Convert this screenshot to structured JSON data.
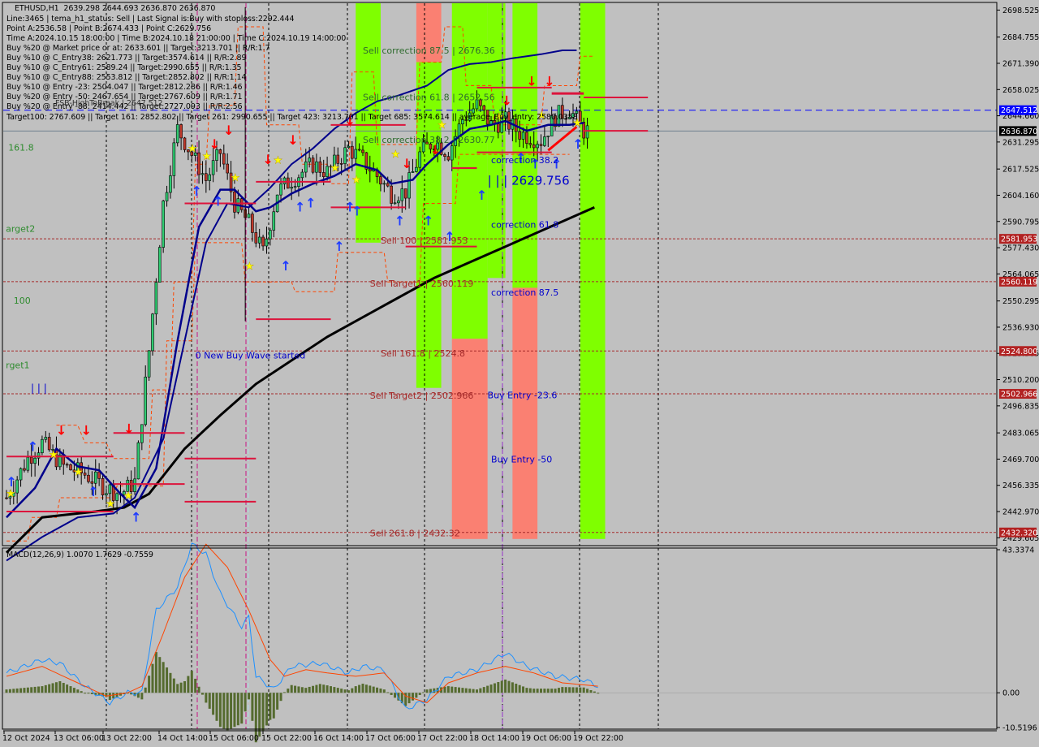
{
  "window": {
    "symbol": "ETHUSD,H1",
    "ohlc": "2639.298 2644.693 2636.870 2636.870"
  },
  "info_lines": [
    "Line:3465 | tema_h1_status: Sell | Last Signal is:Buy with stoploss:2292.444",
    "Point A:2536.58 | Point B:2674.433 | Point C:2629.756",
    "Time A:2024.10.15 18:00:00 | Time B:2024.10.18 21:00:00 | Time C:2024.10.19 14:00:00",
    "Buy %20 @ Market price or at: 2633.601 || Target:3213.701 || R/R:1.7",
    "Buy %10 @ C_Entry38: 2621.773 || Target:3574.614 || R/R:2.89",
    "Buy %10 @ C_Entry61: 2589.24 || Target:2990.655 || R/R:1.35",
    "Buy %10 @ C_Entry88: 2553.812 || Target:2852.802 || R/R:1.14",
    "Buy %10 @ Entry -23: 2504.047 || Target:2812.286 || R/R:1.46",
    "Buy %20 @ Entry -50: 2467.654 || Target:2767.609 || R/R:1.71",
    "Buy %20 @ Entry -88: 2414.442 || Target:2727.093 || R/R:2.56"
  ],
  "targets_line": "Target100: 2767.609 || Target 161: 2852.802 || Target 261: 2990.655 || Target 423: 3213.701 || Target 685: 3574.614 || average_Buy_entry: 2580.0358",
  "fsb_label": "FSB-HighToBreak | 2647.512",
  "chart_data": {
    "type": "candlestick",
    "title": "ETHUSD,H1",
    "price_axis": {
      "ylim": [
        2425.605,
        2702
      ],
      "ticks": [
        "2698.525",
        "2684.755",
        "2671.390",
        "2658.025",
        "2644.660",
        "2631.295",
        "2617.525",
        "2604.160",
        "2590.795",
        "2577.430",
        "2564.065",
        "2550.295",
        "2536.930",
        "2523.565",
        "2510.200",
        "2496.835",
        "2483.065",
        "2469.700",
        "2456.335",
        "2442.970",
        "2429.605"
      ]
    },
    "time_axis": {
      "labels": [
        "12 Oct 2024",
        "13 Oct 06:00",
        "13 Oct 22:00",
        "14 Oct 14:00",
        "15 Oct 06:00",
        "15 Oct 22:00",
        "16 Oct 14:00",
        "17 Oct 06:00",
        "17 Oct 22:00",
        "18 Oct 14:00",
        "19 Oct 06:00",
        "19 Oct 22:00"
      ],
      "bars_total": 185
    },
    "price_tags": [
      {
        "value": "2647.512",
        "price": 2647.512,
        "bg": "#0000ff",
        "fg": "#ffffff"
      },
      {
        "value": "2636.870",
        "price": 2636.87,
        "bg": "#000000",
        "fg": "#ffffff"
      },
      {
        "value": "2581.953",
        "price": 2581.953,
        "bg": "#b22222",
        "fg": "#ffffff"
      },
      {
        "value": "2560.119",
        "price": 2560.119,
        "bg": "#b22222",
        "fg": "#ffffff"
      },
      {
        "value": "2524.800",
        "price": 2524.8,
        "bg": "#b22222",
        "fg": "#ffffff"
      },
      {
        "value": "2502.966",
        "price": 2502.966,
        "bg": "#b22222",
        "fg": "#ffffff"
      },
      {
        "value": "2432.320",
        "price": 2432.32,
        "bg": "#b22222",
        "fg": "#ffffff"
      }
    ],
    "horizontal_levels": [
      {
        "name": "fsb-high-to-break",
        "price": 2647.512,
        "color": "#0000ff",
        "style": "dashed"
      },
      {
        "name": "current-price",
        "price": 2636.87,
        "color": "#708090",
        "style": "solid"
      },
      {
        "name": "sell-100",
        "price": 2581.953,
        "color": "#a52a2a",
        "style": "dotted"
      },
      {
        "name": "sell-target1",
        "price": 2560.119,
        "color": "#a52a2a",
        "style": "dotted"
      },
      {
        "name": "sell-161-8",
        "price": 2524.8,
        "color": "#a52a2a",
        "style": "dotted"
      },
      {
        "name": "sell-target2",
        "price": 2502.966,
        "color": "#a52a2a",
        "style": "dotted"
      },
      {
        "name": "sell-261-8",
        "price": 2432.32,
        "color": "#a52a2a",
        "style": "dotted"
      }
    ],
    "annotations": [
      {
        "text": "Sell correction 87.5 | 2676.36",
        "price": 2676.36,
        "color": "#2e6b2e",
        "bar": 100
      },
      {
        "text": "Sell correction 61.8 | 2652.56",
        "price": 2652.56,
        "color": "#2e6b2e",
        "bar": 100
      },
      {
        "text": "Sell correction 38.2 | 2630.77",
        "price": 2630.77,
        "color": "#2e6b2e",
        "bar": 100
      },
      {
        "text": "Sell 100 | 2581.953",
        "price": 2579.5,
        "color": "#a52a2a",
        "bar": 105
      },
      {
        "text": "Sell Target1 | 2560.119",
        "price": 2557.5,
        "color": "#a52a2a",
        "bar": 102
      },
      {
        "text": "Sell 161.8 | 2524.8",
        "price": 2522.0,
        "color": "#a52a2a",
        "bar": 105
      },
      {
        "text": "Sell Target2 | 2502.966",
        "price": 2500.5,
        "color": "#a52a2a",
        "bar": 102
      },
      {
        "text": "Sell 261.8 | 2432.32",
        "price": 2430.3,
        "color": "#a52a2a",
        "bar": 102
      },
      {
        "text": "correction 38.2",
        "price": 2620.5,
        "color": "#0000cd",
        "bar": 136
      },
      {
        "text": "| | | 2629.756",
        "price": 2609.5,
        "color": "#0000cd",
        "bar": 135,
        "large": true
      },
      {
        "text": "correction 61.8",
        "price": 2587.5,
        "color": "#0000cd",
        "bar": 136
      },
      {
        "text": "correction 87.5",
        "price": 2553.0,
        "color": "#0000cd",
        "bar": 136
      },
      {
        "text": "Buy Entry -23.6",
        "price": 2500.8,
        "color": "#0000cd",
        "bar": 135
      },
      {
        "text": "Buy Entry -50",
        "price": 2468.0,
        "color": "#0000cd",
        "bar": 136
      },
      {
        "text": "0 New Buy Wave started",
        "price": 2521.0,
        "color": "#0000cd",
        "bar": 53
      },
      {
        "text": "161.8",
        "price": 2627.0,
        "color": "#2e8b2e",
        "bar": 0.5
      },
      {
        "text": "arget2",
        "price": 2585.5,
        "color": "#2e8b2e",
        "bar": -0.2
      },
      {
        "text": "100",
        "price": 2549.0,
        "color": "#2e8b2e",
        "bar": 2
      },
      {
        "text": "rget1",
        "price": 2516.0,
        "color": "#2e8b2e",
        "bar": -0.2
      }
    ],
    "zones": [
      {
        "from_bar": 98,
        "to_bar": 105,
        "top": 2702,
        "bottom": 2580,
        "color": "#7fff00"
      },
      {
        "from_bar": 115,
        "to_bar": 122,
        "top": 2702,
        "bottom": 2672,
        "color": "#fa8072"
      },
      {
        "from_bar": 115,
        "to_bar": 122,
        "top": 2672,
        "bottom": 2506,
        "color": "#7fff00"
      },
      {
        "from_bar": 125,
        "to_bar": 135,
        "top": 2702,
        "bottom": 2531,
        "color": "#7fff00"
      },
      {
        "from_bar": 125,
        "to_bar": 135,
        "top": 2531,
        "bottom": 2429,
        "color": "#fa8072"
      },
      {
        "from_bar": 135,
        "to_bar": 140,
        "top": 2702,
        "bottom": 2562,
        "color": "#7fff00"
      },
      {
        "from_bar": 142,
        "to_bar": 149,
        "top": 2702,
        "bottom": 2557,
        "color": "#7fff00"
      },
      {
        "from_bar": 142,
        "to_bar": 149,
        "top": 2557,
        "bottom": 2429,
        "color": "#fa8072"
      },
      {
        "from_bar": 161,
        "to_bar": 168,
        "top": 2702,
        "bottom": 2429,
        "color": "#7fff00"
      }
    ],
    "segments": [
      {
        "x0": 0,
        "x1": 30,
        "y": 2471,
        "color": "#dc143c"
      },
      {
        "x0": 0,
        "x1": 30,
        "y": 2443,
        "color": "#dc143c"
      },
      {
        "x0": 30,
        "x1": 50,
        "y": 2483,
        "color": "#dc143c"
      },
      {
        "x0": 30,
        "x1": 50,
        "y": 2457,
        "color": "#dc143c"
      },
      {
        "x0": 50,
        "x1": 70,
        "y": 2470,
        "color": "#dc143c"
      },
      {
        "x0": 50,
        "x1": 70,
        "y": 2448,
        "color": "#dc143c"
      },
      {
        "x0": 50,
        "x1": 70,
        "y": 2600,
        "color": "#dc143c"
      },
      {
        "x0": 70,
        "x1": 91,
        "y": 2611,
        "color": "#dc143c"
      },
      {
        "x0": 70,
        "x1": 91,
        "y": 2541,
        "color": "#dc143c"
      },
      {
        "x0": 91,
        "x1": 112,
        "y": 2640,
        "color": "#dc143c"
      },
      {
        "x0": 91,
        "x1": 112,
        "y": 2598,
        "color": "#dc143c"
      },
      {
        "x0": 112,
        "x1": 132,
        "y": 2578,
        "color": "#dc143c"
      },
      {
        "x0": 125,
        "x1": 132,
        "y": 2618,
        "color": "#dc143c"
      },
      {
        "x0": 132,
        "x1": 153,
        "y": 2659,
        "color": "#dc143c"
      },
      {
        "x0": 132,
        "x1": 153,
        "y": 2626,
        "color": "#dc143c"
      },
      {
        "x0": 153,
        "x1": 162,
        "y": 2656,
        "color": "#dc143c",
        "thick": true
      },
      {
        "x0": 162,
        "x1": 180,
        "y": 2654,
        "color": "#dc143c"
      },
      {
        "x0": 162,
        "x1": 180,
        "y": 2637,
        "color": "#dc143c"
      }
    ],
    "indicators": {
      "ma_200_color": "#000000",
      "ma_fast_color": "#00008b",
      "ma_slow_color": "#00008b",
      "envelope_color": "#ff4500"
    },
    "macd": {
      "label": "MACD(12,26,9) 1.0070 1.7629 -0.7559",
      "params": "12,26,9",
      "main": 1.007,
      "signal": 1.7629,
      "histogram": -0.7559,
      "ylim": [
        -10.5196,
        43.3374
      ],
      "ticks": [
        "43.3374",
        "0.00",
        "-10.5196"
      ],
      "main_color": "#1e90ff",
      "signal_color": "#ff4500",
      "hist_color": "#556b2f"
    }
  }
}
